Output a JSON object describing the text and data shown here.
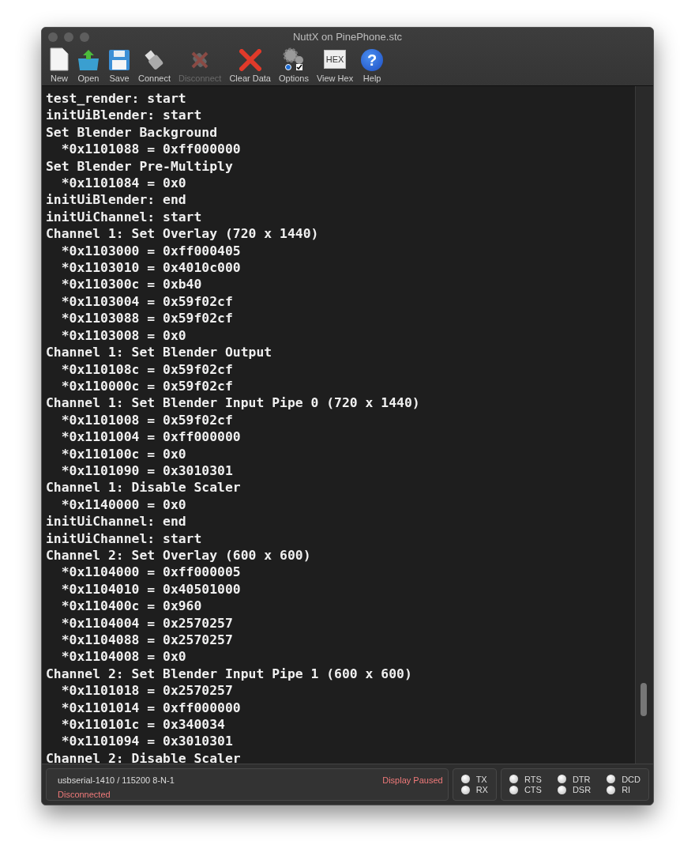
{
  "window": {
    "title": "NuttX on PinePhone.stc"
  },
  "toolbar": [
    {
      "kind": "new",
      "label": "New",
      "disabled": false
    },
    {
      "kind": "open",
      "label": "Open",
      "disabled": false
    },
    {
      "kind": "save",
      "label": "Save",
      "disabled": false
    },
    {
      "kind": "connect",
      "label": "Connect",
      "disabled": false
    },
    {
      "kind": "disconnect",
      "label": "Disconnect",
      "disabled": true
    },
    {
      "kind": "clear",
      "label": "Clear Data",
      "disabled": false
    },
    {
      "kind": "options",
      "label": "Options",
      "disabled": false
    },
    {
      "kind": "hex",
      "label": "View Hex",
      "glyph": "HEX",
      "disabled": false
    },
    {
      "kind": "help",
      "label": "Help",
      "glyph": "?",
      "disabled": false
    }
  ],
  "terminal": {
    "lines": [
      "test_render: start",
      "initUiBlender: start",
      "Set Blender Background",
      "  *0x1101088 = 0xff000000",
      "Set Blender Pre-Multiply",
      "  *0x1101084 = 0x0",
      "initUiBlender: end",
      "initUiChannel: start",
      "Channel 1: Set Overlay (720 x 1440)",
      "  *0x1103000 = 0xff000405",
      "  *0x1103010 = 0x4010c000",
      "  *0x110300c = 0xb40",
      "  *0x1103004 = 0x59f02cf",
      "  *0x1103088 = 0x59f02cf",
      "  *0x1103008 = 0x0",
      "Channel 1: Set Blender Output",
      "  *0x110108c = 0x59f02cf",
      "  *0x110000c = 0x59f02cf",
      "Channel 1: Set Blender Input Pipe 0 (720 x 1440)",
      "  *0x1101008 = 0x59f02cf",
      "  *0x1101004 = 0xff000000",
      "  *0x110100c = 0x0",
      "  *0x1101090 = 0x3010301",
      "Channel 1: Disable Scaler",
      "  *0x1140000 = 0x0",
      "initUiChannel: end",
      "initUiChannel: start",
      "Channel 2: Set Overlay (600 x 600)",
      "  *0x1104000 = 0xff000005",
      "  *0x1104010 = 0x40501000",
      "  *0x110400c = 0x960",
      "  *0x1104004 = 0x2570257",
      "  *0x1104088 = 0x2570257",
      "  *0x1104008 = 0x0",
      "Channel 2: Set Blender Input Pipe 1 (600 x 600)",
      "  *0x1101018 = 0x2570257",
      "  *0x1101014 = 0xff000000",
      "  *0x110101c = 0x340034",
      "  *0x1101094 = 0x3010301",
      "Channel 2: Disable Scaler"
    ]
  },
  "status_bar": {
    "port": "usbserial-1410 / 115200 8-N-1",
    "connection": "Disconnected",
    "display": "Display Paused",
    "signals": [
      {
        "label": "TX"
      },
      {
        "label": "RX"
      }
    ],
    "lines": [
      {
        "label": "RTS"
      },
      {
        "label": "DTR"
      },
      {
        "label": "DCD"
      },
      {
        "label": "CTS"
      },
      {
        "label": "DSR"
      },
      {
        "label": "RI"
      }
    ]
  }
}
